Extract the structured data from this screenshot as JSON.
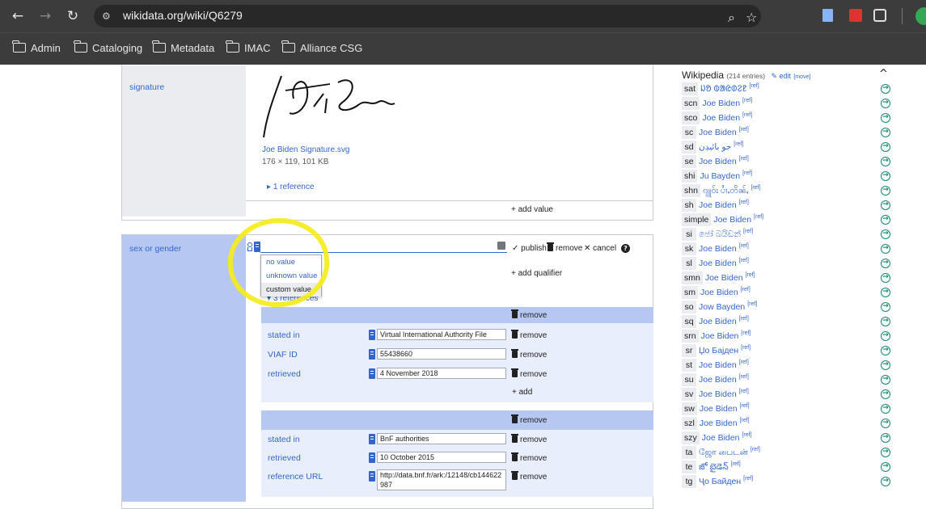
{
  "browser": {
    "url": "wikidata.org/wiki/Q6279",
    "bookmarks": [
      {
        "label": "Admin"
      },
      {
        "label": "Cataloging"
      },
      {
        "label": "Metadata"
      },
      {
        "label": "IMAC"
      },
      {
        "label": "Alliance CSG"
      }
    ]
  },
  "signature": {
    "label": "signature",
    "file_name": "Joe Biden Signature.svg",
    "file_info": "176 × 119, 101 KB",
    "references": "1 reference",
    "add_value": "add value"
  },
  "sex_gender": {
    "label": "sex or gender",
    "publish": "publish",
    "remove": "remove",
    "cancel": "cancel",
    "add_qualifier": "add qualifier",
    "references": "3 references",
    "dropdown": [
      "no value",
      "unknown value",
      "custom value"
    ],
    "dropdown_selected": "custom value"
  },
  "ref1": {
    "remove": "remove",
    "add": "add",
    "rows": [
      {
        "prop": "stated in",
        "value": "Virtual International Authority File"
      },
      {
        "prop": "VIAF ID",
        "value": "55438660"
      },
      {
        "prop": "retrieved",
        "value": "4 November 2018"
      }
    ]
  },
  "ref2": {
    "remove": "remove",
    "rows": [
      {
        "prop": "stated in",
        "value": "BnF authorities"
      },
      {
        "prop": "retrieved",
        "value": "10 October 2015"
      },
      {
        "prop": "reference URL",
        "value": "http://data.bnf.fr/ark:/12148/cb144622987"
      }
    ]
  },
  "wikipedia": {
    "title": "Wikipedia",
    "count": "(214 entries)",
    "edit": "edit",
    "move": "[move]",
    "ref": "[ref]",
    "entries": [
      {
        "code": "sat",
        "title": "ᱡᱚ ᱵᱟᱭᱰᱮᱱ"
      },
      {
        "code": "scn",
        "title": "Joe Biden"
      },
      {
        "code": "sco",
        "title": "Joe Biden"
      },
      {
        "code": "sc",
        "title": "Joe Biden"
      },
      {
        "code": "sd",
        "title": "جو بائيڊن"
      },
      {
        "code": "se",
        "title": "Joe Biden"
      },
      {
        "code": "shi",
        "title": "Ju Bayden"
      },
      {
        "code": "shn",
        "title": "ၵျူဝ်း ပၢႆႇတိၼ်ႇ"
      },
      {
        "code": "sh",
        "title": "Joe Biden"
      },
      {
        "code": "simple",
        "title": "Joe Biden"
      },
      {
        "code": "si",
        "title": "ජෝ බයිඩන්"
      },
      {
        "code": "sk",
        "title": "Joe Biden"
      },
      {
        "code": "sl",
        "title": "Joe Biden"
      },
      {
        "code": "smn",
        "title": "Joe Biden"
      },
      {
        "code": "sm",
        "title": "Joe Biden"
      },
      {
        "code": "so",
        "title": "Jow Bayden"
      },
      {
        "code": "sq",
        "title": "Joe Biden"
      },
      {
        "code": "srn",
        "title": "Joe Biden"
      },
      {
        "code": "sr",
        "title": "Џо Бајден"
      },
      {
        "code": "st",
        "title": "Joe Biden"
      },
      {
        "code": "su",
        "title": "Joe Biden"
      },
      {
        "code": "sv",
        "title": "Joe Biden"
      },
      {
        "code": "sw",
        "title": "Joe Biden"
      },
      {
        "code": "szl",
        "title": "Joe Biden"
      },
      {
        "code": "szy",
        "title": "Joe Biden"
      },
      {
        "code": "ta",
        "title": "ஜோ பைடன்"
      },
      {
        "code": "te",
        "title": "జో బైడెన్"
      },
      {
        "code": "tg",
        "title": "Ҷо Байден"
      }
    ]
  }
}
